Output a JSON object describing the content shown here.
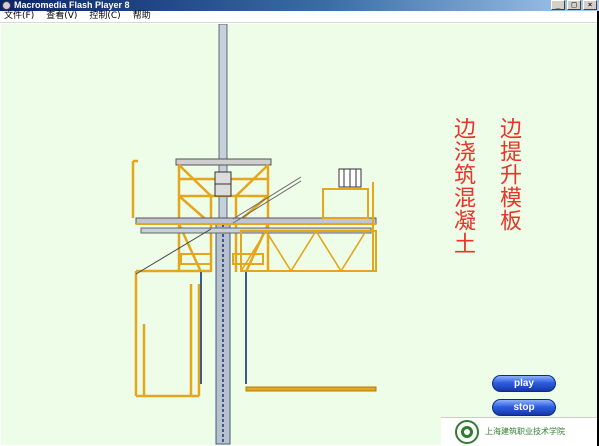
{
  "window": {
    "title": "Macromedia Flash Player 8",
    "controls": {
      "minimize": "_",
      "maximize": "□",
      "close": "×"
    }
  },
  "menu": {
    "items": [
      "文件(F)",
      "查看(V)",
      "控制(C)",
      "帮助"
    ]
  },
  "stage": {
    "title_left": "边浇筑混凝土",
    "title_right": "边提升模板",
    "background": "#eefde8",
    "title_color": "#e8342a"
  },
  "buttons": {
    "play": "play",
    "stop": "stop"
  },
  "logo": {
    "text": "上海建筑职业技术学院"
  },
  "colors": {
    "frame_yellow": "#e3a61c",
    "mast_blue": "#3c5a8a",
    "button_blue": "#2d5fe0"
  },
  "icons": {
    "app": "flash-app-icon",
    "logo": "school-seal-icon"
  }
}
